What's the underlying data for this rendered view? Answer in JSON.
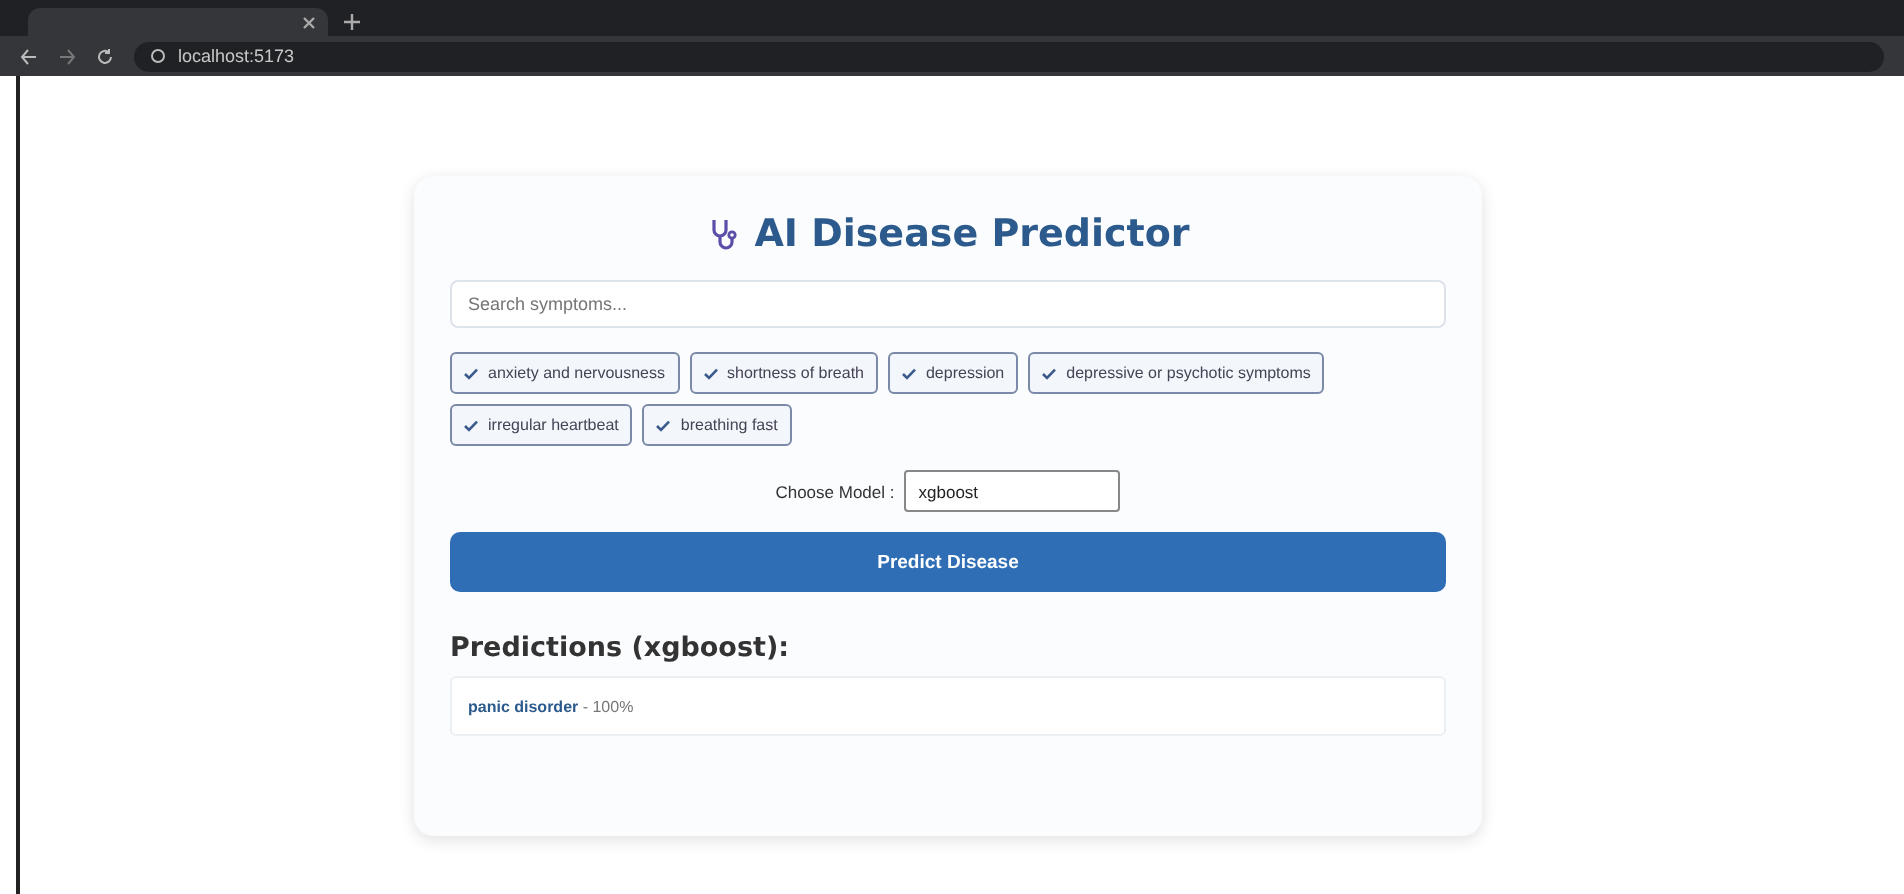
{
  "browser": {
    "address": "localhost:5173"
  },
  "app": {
    "title": "AI Disease Predictor",
    "search": {
      "placeholder": "Search symptoms..."
    },
    "symptoms": [
      {
        "label": "anxiety and nervousness",
        "selected": true
      },
      {
        "label": "shortness of breath",
        "selected": true
      },
      {
        "label": "depression",
        "selected": true
      },
      {
        "label": "depressive or psychotic symptoms",
        "selected": true
      },
      {
        "label": "irregular heartbeat",
        "selected": true
      },
      {
        "label": "breathing fast",
        "selected": true
      }
    ],
    "model": {
      "label": "Choose Model :",
      "value": "xgboost"
    },
    "predict_button": "Predict Disease",
    "predictions": {
      "heading": "Predictions (xgboost):",
      "items": [
        {
          "disease": "panic disorder",
          "score": " - 100%"
        }
      ]
    }
  }
}
